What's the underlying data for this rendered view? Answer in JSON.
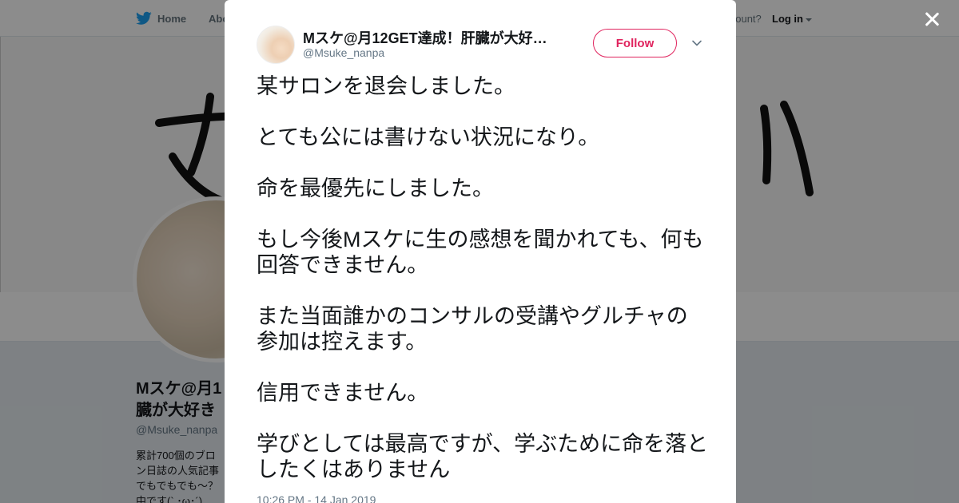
{
  "nav": {
    "home_label": "Home",
    "about_label": "Abo",
    "account_prompt": "account?",
    "login_label": "Log in"
  },
  "profile": {
    "name": "Mスケ@月12GET達成！肝臓が大好き",
    "name_line1": "Mスケ@月1",
    "name_line2": "臓が大好き",
    "handle": "@Msuke_nanpa",
    "bio_lines": [
      "累計700個のブロ",
      "ン日誌の人気記事",
      "でもでもでも〜？",
      "中です(` ･ω･´)"
    ]
  },
  "tweet": {
    "author_name": "Mスケ@月12GET達成！肝臓が大好き…",
    "author_handle": "@Msuke_nanpa",
    "follow_label": "Follow",
    "text": "某サロンを退会しました。\n\nとても公には書けない状況になり。\n\n命を最優先にしました。\n\nもし今後Mスケに生の感想を聞かれても、何も回答できません。\n\nまた当面誰かのコンサルの受講やグルチャの参加は控えます。\n\n信用できません。\n\n学びとしては最高ですが、学ぶために命を落としたくはありません",
    "timestamp": "10:26 PM - 14 Jan 2019"
  },
  "colors": {
    "accent": "#e0245e",
    "twitter_blue": "#1da1f2",
    "overlay": "rgba(0,0,0,0.45)"
  },
  "icons": [
    "twitter-bird-icon",
    "caret-down-icon",
    "close-icon",
    "chevron-down-icon"
  ]
}
